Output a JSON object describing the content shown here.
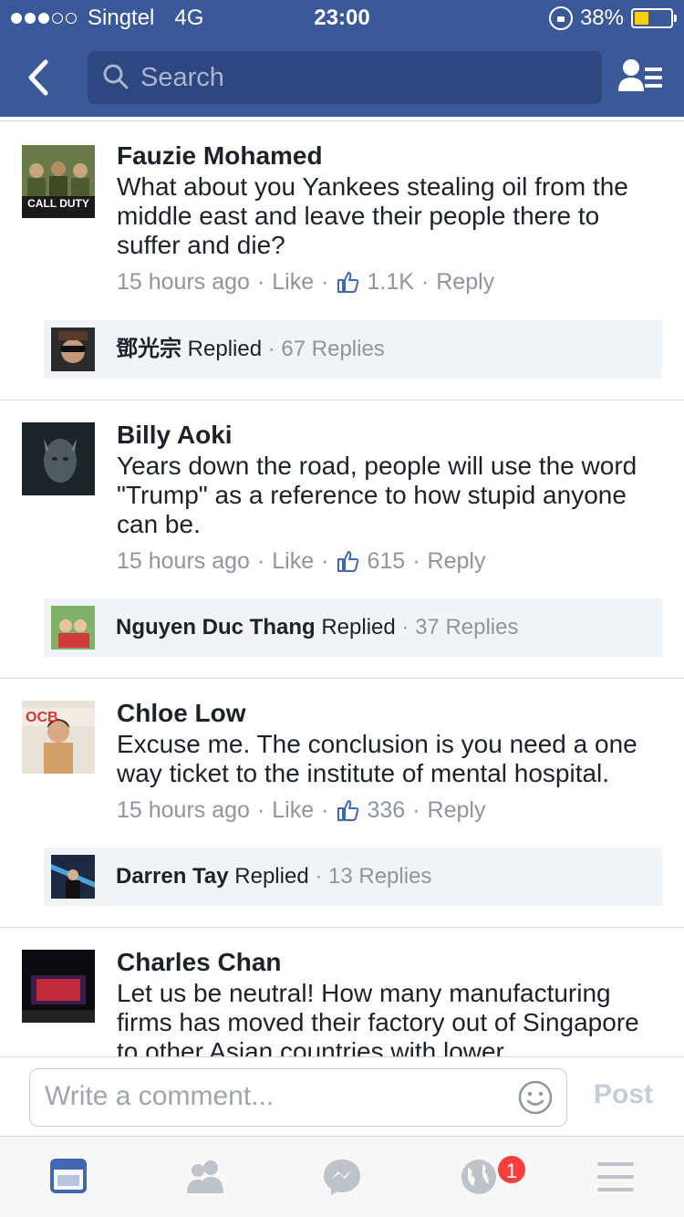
{
  "status_bar": {
    "carrier": "Singtel",
    "network": "4G",
    "time": "23:00",
    "battery": "38%",
    "battery_level": 0.38,
    "signal_bars_filled": 3,
    "signal_bars_total": 5
  },
  "header": {
    "search_placeholder": "Search",
    "back_icon": "chevron-left-icon",
    "friends_icon": "friend-requests-icon",
    "color": "#3b5998"
  },
  "comments": [
    {
      "author": "Fauzie Mohamed",
      "text": "What about you Yankees stealing oil from the middle east and leave their people there to suffer and die?",
      "time": "15 hours ago",
      "like_label": "Like",
      "likes": "1.1K",
      "reply_label": "Reply",
      "avatar_caption": "CALL DUTY",
      "replies": {
        "name": "鄧光宗",
        "replied_label": "Replied",
        "count": "67 Replies"
      }
    },
    {
      "author": "Billy Aoki",
      "text": "Years down the road, people will use the word \"Trump\" as a reference to how stupid anyone can be.",
      "time": "15 hours ago",
      "like_label": "Like",
      "likes": "615",
      "reply_label": "Reply",
      "replies": {
        "name": "Nguyen Duc Thang",
        "replied_label": "Replied",
        "count": "37 Replies"
      }
    },
    {
      "author": "Chloe Low",
      "text": "Excuse me. The conclusion is you need a one way ticket to the institute of mental hospital.",
      "time": "15 hours ago",
      "like_label": "Like",
      "likes": "336",
      "reply_label": "Reply",
      "avatar_caption": "OCB",
      "replies": {
        "name": "Darren Tay",
        "replied_label": "Replied",
        "count": "13 Replies"
      }
    },
    {
      "author": "Charles Chan",
      "text": "Let us be neutral! How many manufacturing firms has moved their factory out of Singapore to other Asian countries with lower",
      "time": "",
      "like_label": "",
      "likes": "",
      "reply_label": ""
    }
  ],
  "composer": {
    "placeholder": "Write a comment...",
    "post_label": "Post",
    "emoji_icon": "emoji-icon"
  },
  "tabbar": {
    "tabs": [
      "news-feed-icon",
      "friends-icon",
      "messenger-icon",
      "notifications-globe-icon",
      "menu-icon"
    ],
    "notification_badge": "1",
    "active_color": "#4267b2",
    "inactive_color": "#bec3c9"
  },
  "colors": {
    "brand_blue": "#3b5998",
    "meta_gray": "#90949c",
    "like_blue": "#4267b2",
    "badge_red": "#fa3e3e"
  }
}
